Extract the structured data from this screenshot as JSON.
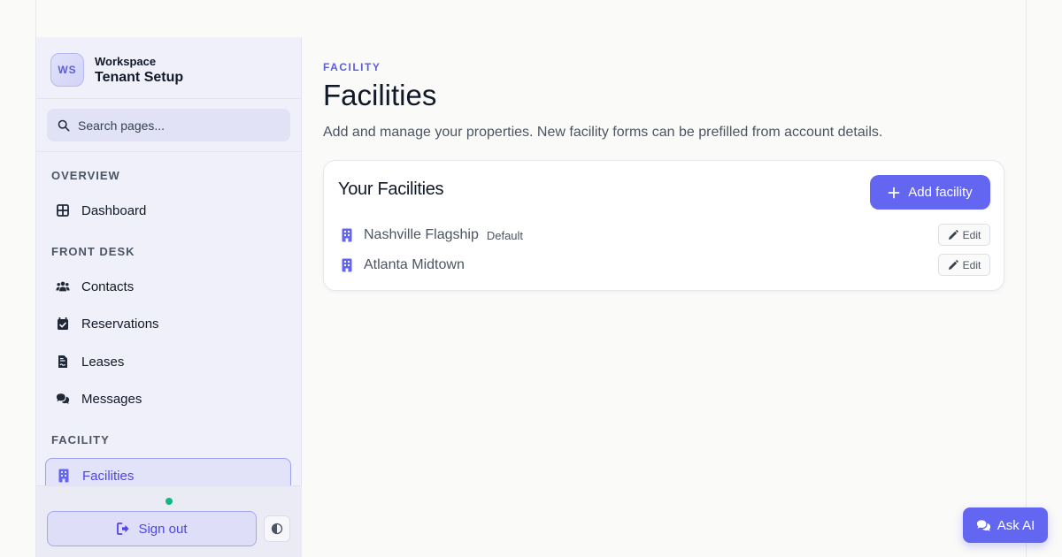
{
  "workspace": {
    "avatar_initials": "WS",
    "kicker": "Workspace",
    "title": "Tenant Setup"
  },
  "search": {
    "placeholder": "Search pages..."
  },
  "sidebar": {
    "sections": [
      {
        "label": "OVERVIEW"
      },
      {
        "label": "FRONT DESK"
      },
      {
        "label": "FACILITY"
      }
    ],
    "items": [
      {
        "label": "Dashboard",
        "icon": "grid-icon",
        "active": false
      },
      {
        "label": "Contacts",
        "icon": "users-icon",
        "active": false
      },
      {
        "label": "Reservations",
        "icon": "calendar-check-icon",
        "active": false
      },
      {
        "label": "Leases",
        "icon": "file-contract-icon",
        "active": false
      },
      {
        "label": "Messages",
        "icon": "chat-bubbles-icon",
        "active": false
      },
      {
        "label": "Facilities",
        "icon": "building-icon",
        "active": true
      }
    ],
    "footer": {
      "status": "online",
      "signout_label": "Sign out",
      "theme_icon": "contrast-icon"
    }
  },
  "main": {
    "kicker": "FACILITY",
    "title": "Facilities",
    "description": "Add and manage your properties. New facility forms can be prefilled from account details.",
    "card": {
      "title": "Your Facilities",
      "add_label": "Add facility",
      "facilities": [
        {
          "name": "Nashville Flagship",
          "badge": "Default",
          "edit_label": "Edit"
        },
        {
          "name": "Atlanta Midtown",
          "badge": "",
          "edit_label": "Edit"
        }
      ]
    }
  },
  "assistant": {
    "label": "Ask AI"
  },
  "colors": {
    "accent": "#6366f1",
    "accent_text": "#4f46e5",
    "status_online": "#10b981",
    "sidebar_bg": "#f0f0fa"
  }
}
